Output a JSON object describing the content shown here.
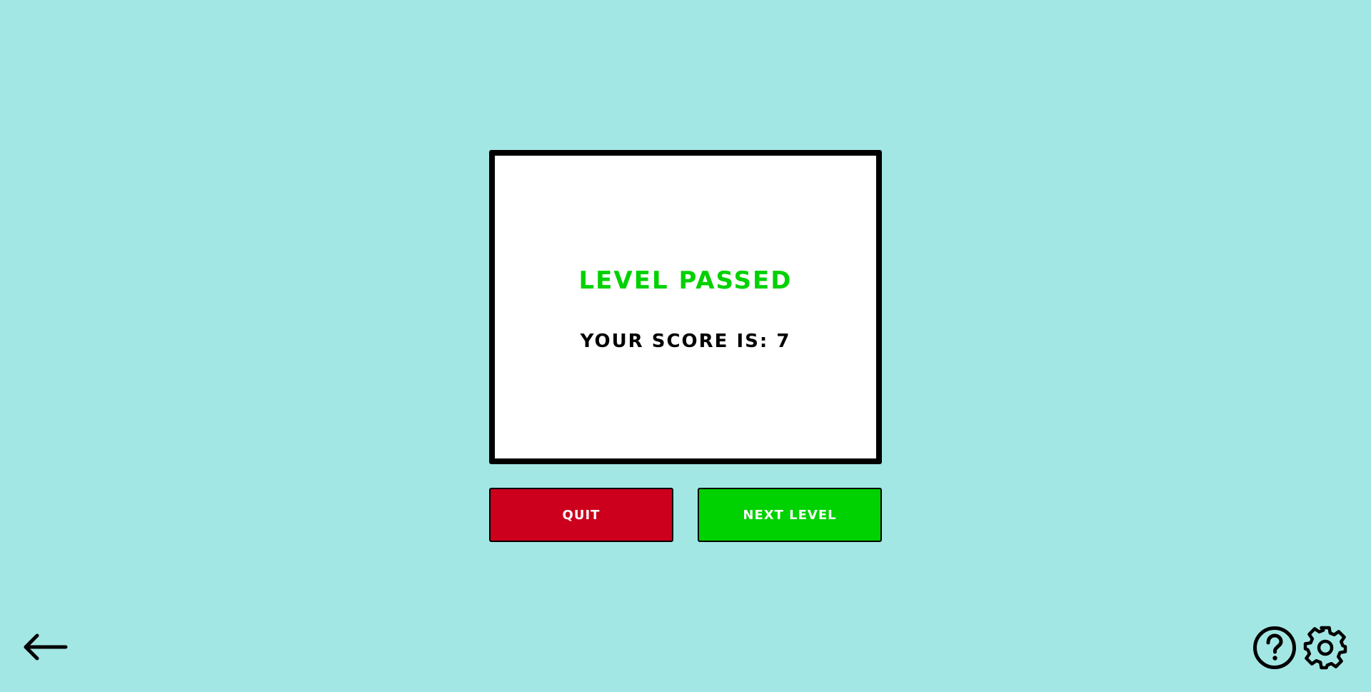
{
  "result": {
    "title": "LEVEL PASSED",
    "score_text": "YOUR SCORE IS: 7"
  },
  "buttons": {
    "quit_label": "QUIT",
    "next_label": "NEXT LEVEL"
  },
  "icons": {
    "back": "arrow-left-icon",
    "help": "question-circle-icon",
    "settings": "gear-icon"
  },
  "colors": {
    "background": "#a3e7e4",
    "title": "#00d100",
    "quit": "#cc001c",
    "next": "#00d100"
  }
}
